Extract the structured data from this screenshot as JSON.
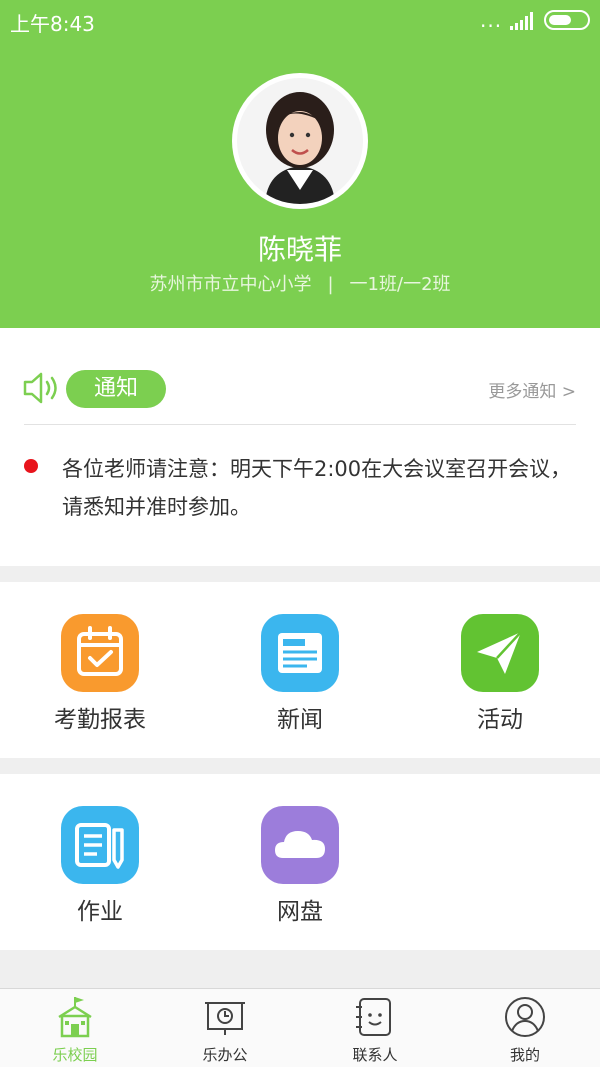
{
  "status_bar": {
    "time": "上午8:43",
    "dots": "..."
  },
  "profile": {
    "name": "陈晓菲",
    "school": "苏州市市立中心小学",
    "separator": "|",
    "classes": "一1班/一2班"
  },
  "notice": {
    "badge": "通知",
    "more": "更多通知 >",
    "text": "各位老师请注意：明天下午2:00在大会议室召开会议，请悉知并准时参加。"
  },
  "grid": {
    "row1": [
      {
        "label": "考勤报表",
        "icon": "calendar-check-icon",
        "color": "#f99a2e"
      },
      {
        "label": "新闻",
        "icon": "news-icon",
        "color": "#3bb6ee"
      },
      {
        "label": "活动",
        "icon": "paper-plane-icon",
        "color": "#62c332"
      }
    ],
    "row2": [
      {
        "label": "作业",
        "icon": "homework-icon",
        "color": "#3bb6ee"
      },
      {
        "label": "网盘",
        "icon": "cloud-icon",
        "color": "#9c7ddb"
      }
    ]
  },
  "bottom_nav": [
    {
      "label": "乐校园",
      "icon": "school-icon",
      "active": true
    },
    {
      "label": "乐办公",
      "icon": "office-icon",
      "active": false
    },
    {
      "label": "联系人",
      "icon": "contacts-icon",
      "active": false
    },
    {
      "label": "我的",
      "icon": "profile-icon",
      "active": false
    }
  ],
  "colors": {
    "accent": "#7ccf50",
    "alert": "#e8141c"
  }
}
